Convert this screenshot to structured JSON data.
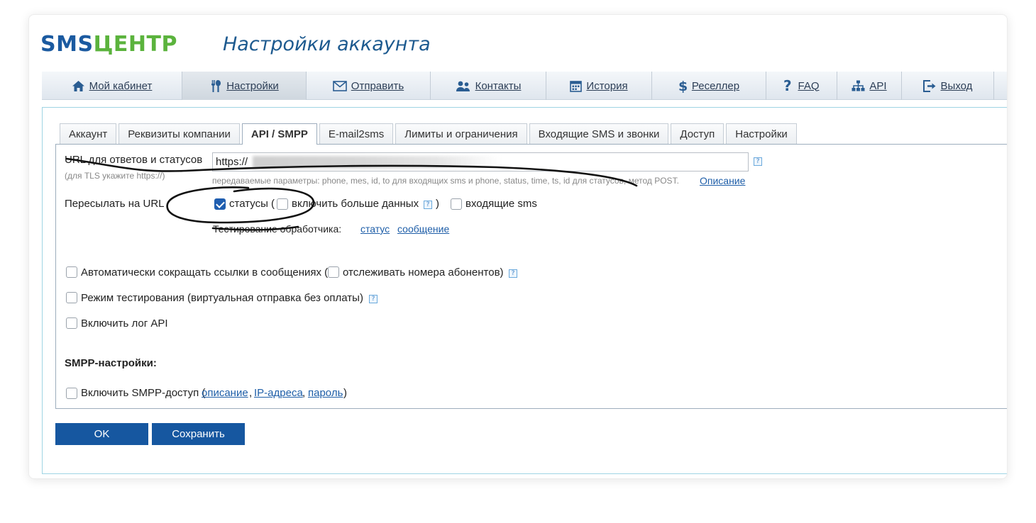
{
  "brand": {
    "logo_sms": "SMS",
    "logo_centr": "ЦЕНТР",
    "logo_colors": {
      "sms": "#1b5aa0",
      "centr": "#5bb33d"
    }
  },
  "page_title": "Настройки аккаунта",
  "nav": [
    {
      "label": "Мой кабинет",
      "icon": "home-icon"
    },
    {
      "label": "Настройки",
      "icon": "tools-icon",
      "active": true
    },
    {
      "label": "Отправить",
      "icon": "envelope-icon"
    },
    {
      "label": "Контакты",
      "icon": "users-icon"
    },
    {
      "label": "История",
      "icon": "calendar-icon"
    },
    {
      "label": "Реселлер",
      "icon": "dollar-icon"
    },
    {
      "label": "FAQ",
      "icon": "question-icon"
    },
    {
      "label": "API",
      "icon": "sitemap-icon"
    },
    {
      "label": "Выход",
      "icon": "logout-icon"
    }
  ],
  "subtabs": [
    {
      "label": "Аккаунт"
    },
    {
      "label": "Реквизиты компании"
    },
    {
      "label": "API / SMPP",
      "active": true
    },
    {
      "label": "E-mail2sms"
    },
    {
      "label": "Лимиты и ограничения"
    },
    {
      "label": "Входящие SMS и звонки"
    },
    {
      "label": "Доступ"
    },
    {
      "label": "Настройки"
    }
  ],
  "api": {
    "url_label": "URL для ответов и статусов",
    "url_hint": "(для TLS укажите https://)",
    "url_value": "https://",
    "params_text": "передаваемые параметры: phone, mes, id, to для входящих sms и phone, status, time, ts, id для статусов, метод POST.",
    "params_link": "Описание",
    "forward_label": "Пересылать на URL",
    "statuses_label": "статусы (",
    "statuses_checked": true,
    "more_data_label": "включить больше данных",
    "more_data_checked": false,
    "close_paren": ")",
    "incoming_label": "входящие sms",
    "incoming_checked": false,
    "test_label": "Тестирование обработчика:",
    "test_status": "статус",
    "test_message": "сообщение",
    "shorten_label": "Автоматически сокращать ссылки в сообщениях (",
    "shorten_checked": false,
    "track_label": "отслеживать номера абонентов)",
    "track_checked": false,
    "testmode_label": "Режим тестирования (виртуальная отправка без оплаты)",
    "testmode_checked": false,
    "log_label": "Включить лог API",
    "log_checked": false
  },
  "smpp": {
    "heading": "SMPP-настройки:",
    "enable_label": "Включить SMPP-доступ (",
    "enable_checked": false,
    "link_description": "описание",
    "sep1": ",",
    "link_ips": "IP-адреса",
    "sep2": ",",
    "link_password": "пароль",
    "close": ")"
  },
  "buttons": {
    "ok": "OK",
    "save": "Сохранить"
  },
  "help_glyph": "?"
}
